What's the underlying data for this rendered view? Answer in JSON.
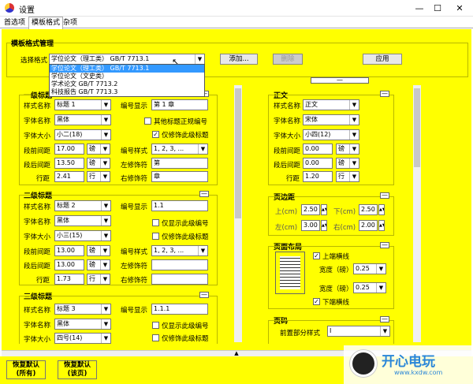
{
  "window": {
    "title": "设置",
    "minimize": "—",
    "maximize": "☐",
    "close": "✕"
  },
  "tabs": [
    "首选项",
    "模板格式",
    "杂项"
  ],
  "group_title": "模板格式管理",
  "select_label": "选择格式",
  "select_value": "学位论文（理工类） GB/T 7713.1",
  "dropdown_options": [
    "学位论文（理工类） GB/T 7713.1",
    "学位论文（文史类）",
    "学术论文 GB/T 7713.2",
    "科技报告 GB/T 7713.3"
  ],
  "buttons": {
    "add": "添加...",
    "delete": "删除",
    "apply": "应用"
  },
  "level1": {
    "title": "一级标题",
    "style_label": "样式名称",
    "style_value": "标题 1",
    "font_label": "字体名称",
    "font_value": "黑体",
    "size_label": "字体大小",
    "size_value": "小二(18)",
    "before_label": "段前间距",
    "before_value": "17.00",
    "before_unit": "磅",
    "after_label": "段后间距",
    "after_value": "13.50",
    "after_unit": "磅",
    "line_label": "行距",
    "line_value": "2.41",
    "line_unit": "行",
    "num_display_label": "编号显示",
    "num_display_value": "第 1 章",
    "chk1": "其他标题正规编号",
    "chk2": "仅修饰此级标题",
    "num_style_label": "编号样式",
    "num_style_value": "1, 2, 3, ...",
    "left_deco_label": "左修饰符",
    "left_deco_value": "第",
    "right_deco_label": "右修饰符",
    "right_deco_value": "章"
  },
  "level2": {
    "title": "二级标题",
    "style_label": "样式名称",
    "style_value": "标题 2",
    "font_label": "字体名称",
    "font_value": "黑体",
    "size_label": "字体大小",
    "size_value": "小三(15)",
    "before_label": "段前间距",
    "before_value": "13.00",
    "before_unit": "磅",
    "after_label": "段后间距",
    "after_value": "13.00",
    "after_unit": "磅",
    "line_label": "行距",
    "line_value": "1.73",
    "line_unit": "行",
    "num_display_label": "编号显示",
    "num_display_value": "1.1",
    "chk1": "仅显示此级编号",
    "chk2": "仅修饰此级标题",
    "num_style_label": "编号样式",
    "num_style_value": "1, 2, 3, ...",
    "left_deco_label": "左修饰符",
    "left_deco_value": "",
    "right_deco_label": "右修饰符",
    "right_deco_value": ""
  },
  "level3": {
    "title": "三级标题",
    "style_label": "样式名称",
    "style_value": "标题 3",
    "font_label": "字体名称",
    "font_value": "黑体",
    "size_label": "字体大小",
    "size_value": "四号(14)",
    "num_display_label": "编号显示",
    "num_display_value": "1.1.1",
    "chk1": "仅显示此级编号",
    "chk2": "仅修饰此级标题"
  },
  "body_text": {
    "title": "正文",
    "style_label": "样式名称",
    "style_value": "正文",
    "font_label": "字体名称",
    "font_value": "宋体",
    "size_label": "字体大小",
    "size_value": "小四(12)",
    "before_label": "段前间距",
    "before_value": "0.00",
    "before_unit": "磅",
    "after_label": "段后间距",
    "after_value": "0.00",
    "after_unit": "磅",
    "line_label": "行距",
    "line_value": "1.20",
    "line_unit": "行"
  },
  "margins": {
    "title": "页边距",
    "top_label": "上(cm)",
    "top_value": "2.50",
    "bottom_label": "下(cm)",
    "bottom_value": "2.50",
    "left_label": "左(cm)",
    "left_value": "3.00",
    "right_label": "右(cm)",
    "right_value": "2.00"
  },
  "layout": {
    "title": "页面布局",
    "top_line": "上端横线",
    "width1_label": "宽度（磅）",
    "width1_value": "0.25",
    "width2_label": "宽度（磅）",
    "width2_value": "0.25",
    "bottom_line": "下端横线"
  },
  "page_num": {
    "title": "页码",
    "front_label": "前置部分样式",
    "front_value": "I"
  },
  "bottom_buttons": {
    "restore_all_1": "恢复默认",
    "restore_all_2": "(所有)",
    "restore_page_1": "恢复默认",
    "restore_page_2": "(该页)"
  },
  "watermark": {
    "text": "开心电玩",
    "url": "www.kxdw.com"
  }
}
